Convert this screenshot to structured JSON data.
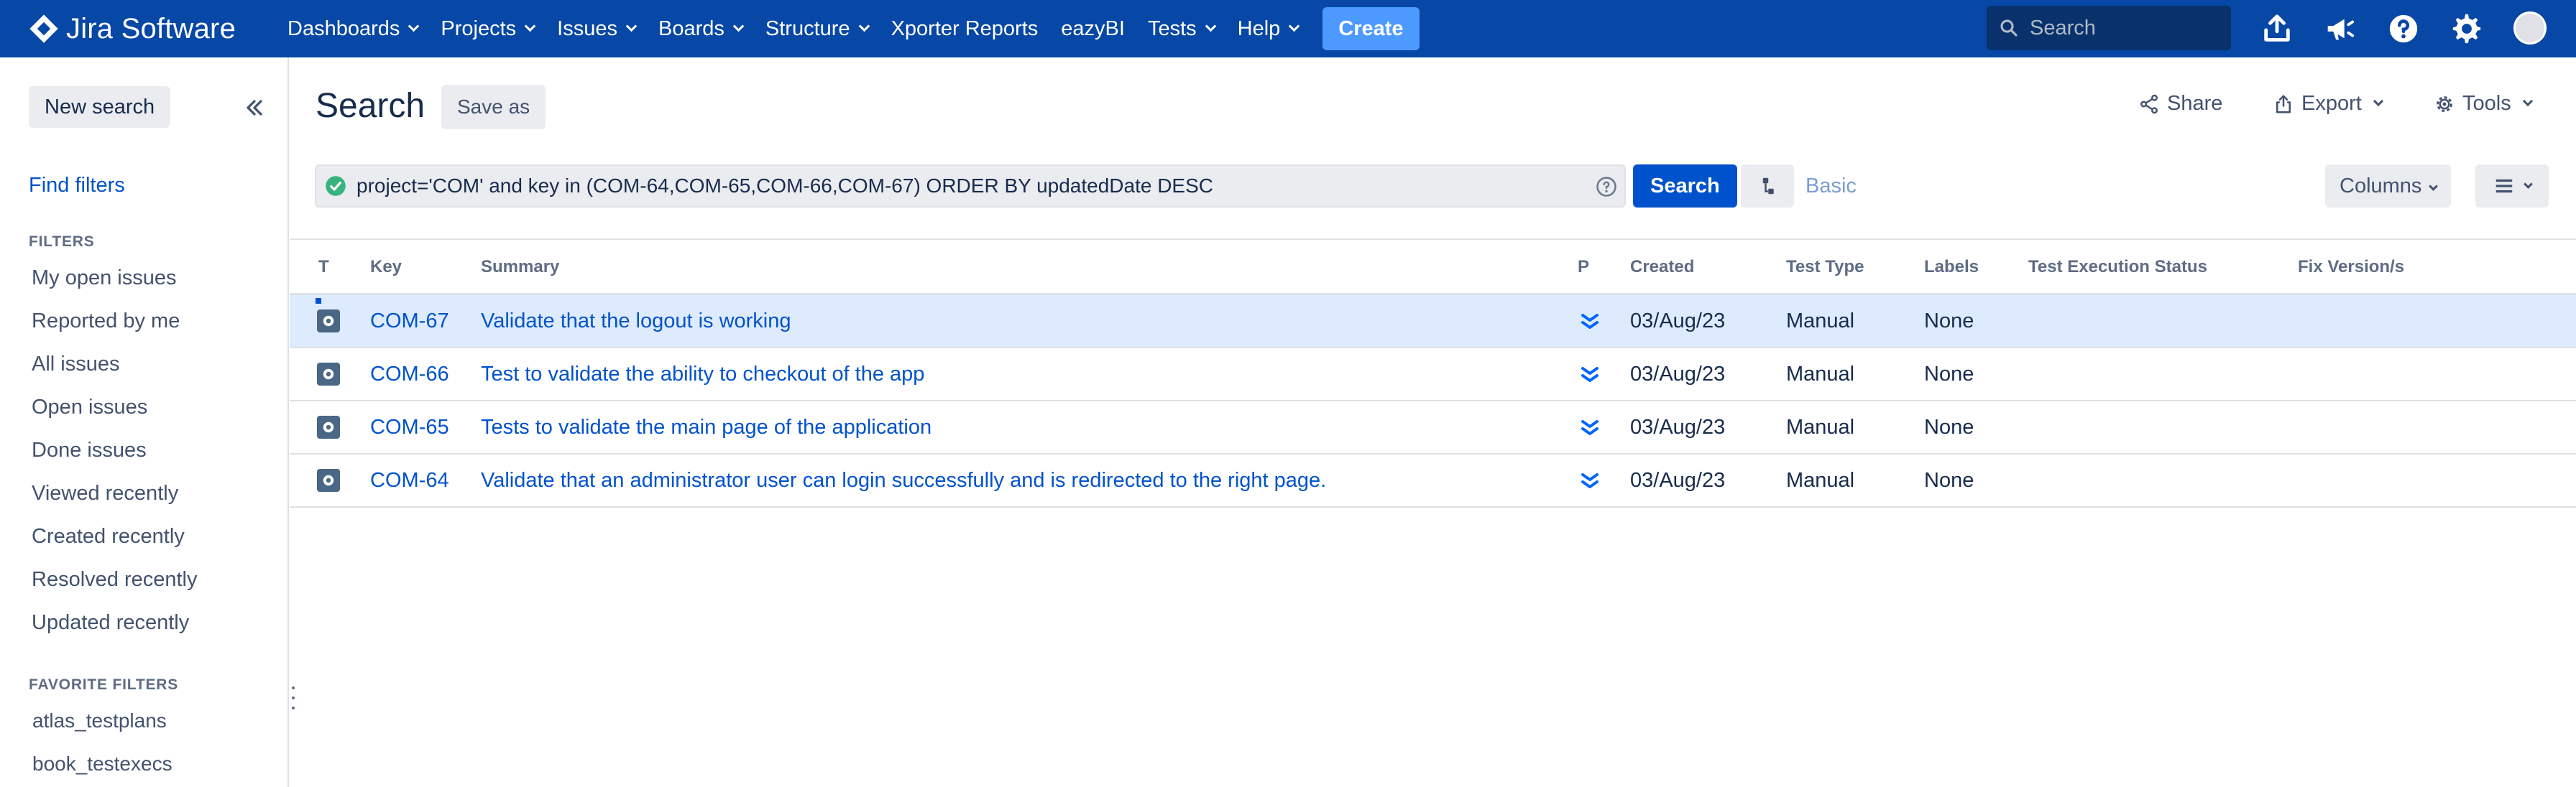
{
  "topnav": {
    "logo_text": "Jira Software",
    "items": [
      {
        "label": "Dashboards"
      },
      {
        "label": "Projects"
      },
      {
        "label": "Issues"
      },
      {
        "label": "Boards"
      },
      {
        "label": "Structure"
      },
      {
        "label": "Xporter Reports"
      },
      {
        "label": "eazyBI"
      },
      {
        "label": "Tests"
      },
      {
        "label": "Help"
      }
    ],
    "create_label": "Create",
    "search_placeholder": "Search",
    "icons": [
      "upload-icon",
      "megaphone-icon",
      "help-icon",
      "settings-icon",
      "avatar"
    ],
    "bg_color": "#0747a6",
    "accent_color": "#4c9aff"
  },
  "sidebar": {
    "new_search_label": "New search",
    "find_filters_label": "Find filters",
    "filters_heading": "FILTERS",
    "filters": [
      {
        "label": "My open issues"
      },
      {
        "label": "Reported by me"
      },
      {
        "label": "All issues"
      },
      {
        "label": "Open issues"
      },
      {
        "label": "Done issues"
      },
      {
        "label": "Viewed recently"
      },
      {
        "label": "Created recently"
      },
      {
        "label": "Resolved recently"
      },
      {
        "label": "Updated recently"
      }
    ],
    "favorites_heading": "FAVORITE FILTERS",
    "favorites": [
      {
        "label": "atlas_testplans"
      },
      {
        "label": "book_testexecs"
      }
    ]
  },
  "header": {
    "title": "Search",
    "save_as_label": "Save as",
    "share_label": "Share",
    "export_label": "Export",
    "tools_label": "Tools"
  },
  "query": {
    "jql": "project='COM' and key in (COM-64,COM-65,COM-66,COM-67) ORDER BY updatedDate DESC",
    "search_label": "Search",
    "basic_label": "Basic",
    "columns_label": "Columns"
  },
  "table": {
    "columns": {
      "t": "T",
      "key": "Key",
      "summary": "Summary",
      "p": "P",
      "created": "Created",
      "test_type": "Test Type",
      "labels": "Labels",
      "exec_status": "Test Execution Status",
      "fix_versions": "Fix Version/s"
    },
    "rows": [
      {
        "key": "COM-67",
        "summary": "Validate that the logout is working",
        "created": "03/Aug/23",
        "test_type": "Manual",
        "labels": "None",
        "exec_status": "",
        "fix_versions": "",
        "selected": true
      },
      {
        "key": "COM-66",
        "summary": "Test to validate the ability to checkout of the app",
        "created": "03/Aug/23",
        "test_type": "Manual",
        "labels": "None",
        "exec_status": "",
        "fix_versions": "",
        "selected": false
      },
      {
        "key": "COM-65",
        "summary": "Tests to validate the main page of the application",
        "created": "03/Aug/23",
        "test_type": "Manual",
        "labels": "None",
        "exec_status": "",
        "fix_versions": "",
        "selected": false
      },
      {
        "key": "COM-64",
        "summary": "Validate that an administrator user can login successfully and is redirected to the right page.",
        "created": "03/Aug/23",
        "test_type": "Manual",
        "labels": "None",
        "exec_status": "",
        "fix_versions": "",
        "selected": false
      }
    ],
    "selected_row_color": "#deebff",
    "link_color": "#0052cc"
  }
}
